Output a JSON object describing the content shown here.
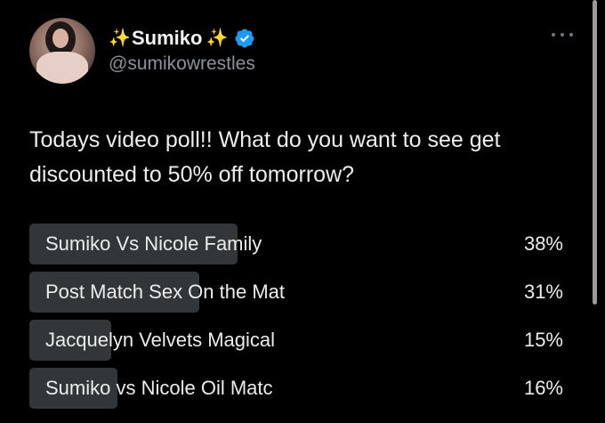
{
  "author": {
    "display_name": "Sumiko",
    "sparkle_left": "✨",
    "sparkle_right": "✨",
    "handle": "@sumikowrestles",
    "verified": true,
    "verified_color": "#1d9bf0"
  },
  "tweet": {
    "text_line1": "Todays video poll!! What do you want to see get",
    "text_line2": "discounted to 50% off tomorrow?"
  },
  "poll": {
    "options": [
      {
        "label": "Sumiko Vs Nicole Family",
        "percent_text": "38%",
        "percent": 38
      },
      {
        "label": "Post Match Sex On the Mat",
        "percent_text": "31%",
        "percent": 31
      },
      {
        "label": "Jacquelyn Velvets Magical",
        "percent_text": "15%",
        "percent": 15
      },
      {
        "label": "Sumiko vs Nicole Oil Matc",
        "percent_text": "16%",
        "percent": 16
      }
    ]
  },
  "colors": {
    "background": "#000000",
    "bar": "#333639",
    "handle": "#8b9198"
  }
}
